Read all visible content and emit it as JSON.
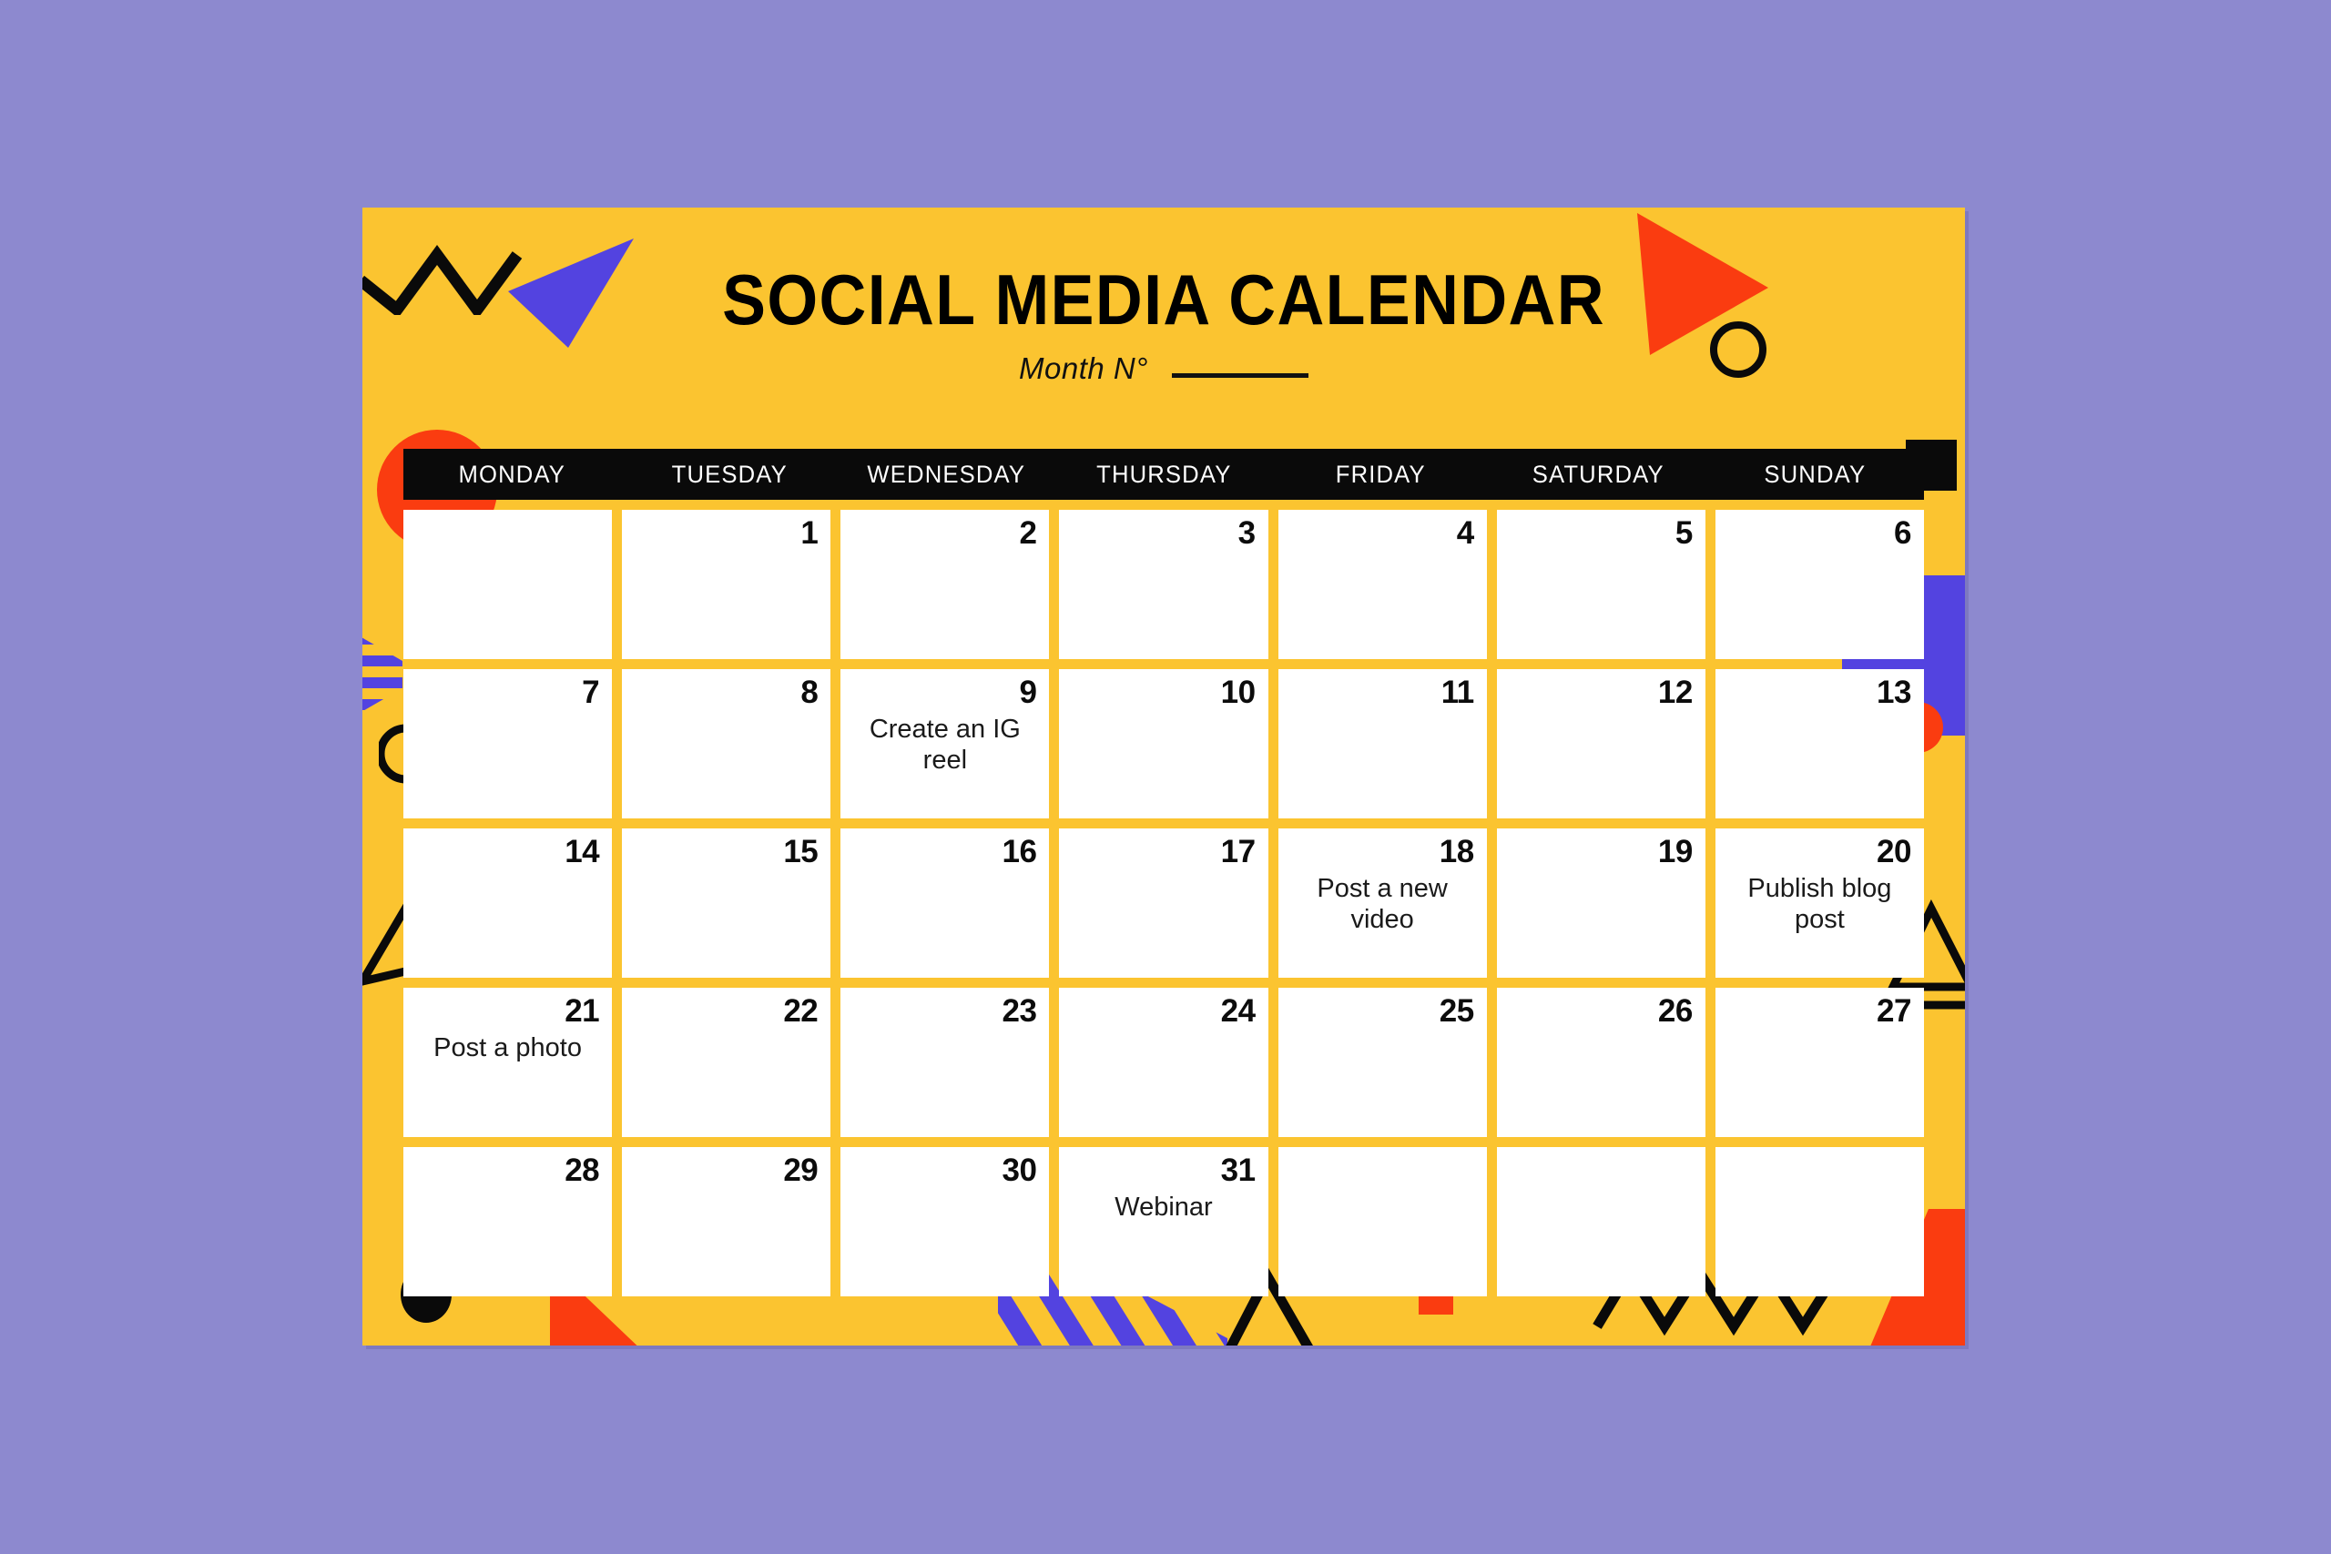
{
  "colors": {
    "background": "#8d89cf",
    "card": "#fbc430",
    "header_bar": "#0a0a0a",
    "cell": "#ffffff",
    "accent_red": "#fa3c10",
    "accent_blue": "#5343e0",
    "text_dark": "#0c0c0c",
    "text_light": "#ffffff"
  },
  "header": {
    "title": "SOCIAL MEDIA CALENDAR",
    "subtitle": "Month N°",
    "month_value": ""
  },
  "calendar": {
    "weekdays": [
      "MONDAY",
      "TUESDAY",
      "WEDNESDAY",
      "THURSDAY",
      "FRIDAY",
      "SATURDAY",
      "SUNDAY"
    ],
    "weeks": [
      [
        {
          "day": "",
          "event": ""
        },
        {
          "day": "1",
          "event": ""
        },
        {
          "day": "2",
          "event": ""
        },
        {
          "day": "3",
          "event": ""
        },
        {
          "day": "4",
          "event": ""
        },
        {
          "day": "5",
          "event": ""
        },
        {
          "day": "6",
          "event": ""
        }
      ],
      [
        {
          "day": "7",
          "event": ""
        },
        {
          "day": "8",
          "event": ""
        },
        {
          "day": "9",
          "event": "Create an IG reel"
        },
        {
          "day": "10",
          "event": ""
        },
        {
          "day": "11",
          "event": ""
        },
        {
          "day": "12",
          "event": ""
        },
        {
          "day": "13",
          "event": ""
        }
      ],
      [
        {
          "day": "14",
          "event": ""
        },
        {
          "day": "15",
          "event": ""
        },
        {
          "day": "16",
          "event": ""
        },
        {
          "day": "17",
          "event": ""
        },
        {
          "day": "18",
          "event": "Post a new video"
        },
        {
          "day": "19",
          "event": ""
        },
        {
          "day": "20",
          "event": "Publish blog post"
        }
      ],
      [
        {
          "day": "21",
          "event": "Post a photo"
        },
        {
          "day": "22",
          "event": ""
        },
        {
          "day": "23",
          "event": ""
        },
        {
          "day": "24",
          "event": ""
        },
        {
          "day": "25",
          "event": ""
        },
        {
          "day": "26",
          "event": ""
        },
        {
          "day": "27",
          "event": ""
        }
      ],
      [
        {
          "day": "28",
          "event": ""
        },
        {
          "day": "29",
          "event": ""
        },
        {
          "day": "30",
          "event": ""
        },
        {
          "day": "31",
          "event": "Webinar"
        },
        {
          "day": "",
          "event": ""
        },
        {
          "day": "",
          "event": ""
        },
        {
          "day": "",
          "event": ""
        }
      ]
    ]
  },
  "decorations": [
    "zigzag-top-left",
    "blue-triangle-top-left",
    "red-triangle-top-right",
    "black-circle-outline-top-right",
    "black-square-right",
    "red-circle-monday",
    "blue-rectangle-right",
    "blue-bar-right",
    "red-circle-right",
    "blue-striped-triangle-left",
    "black-circle-outline-left",
    "black-triangle-outline-left",
    "black-triangle-outline-right",
    "black-circle-bottom-left",
    "red-triangle-bottom",
    "blue-striped-triangle-bottom",
    "black-chevron-bottom",
    "red-square-bottom",
    "zigzag-bottom-right",
    "red-arrow-bottom-right"
  ]
}
